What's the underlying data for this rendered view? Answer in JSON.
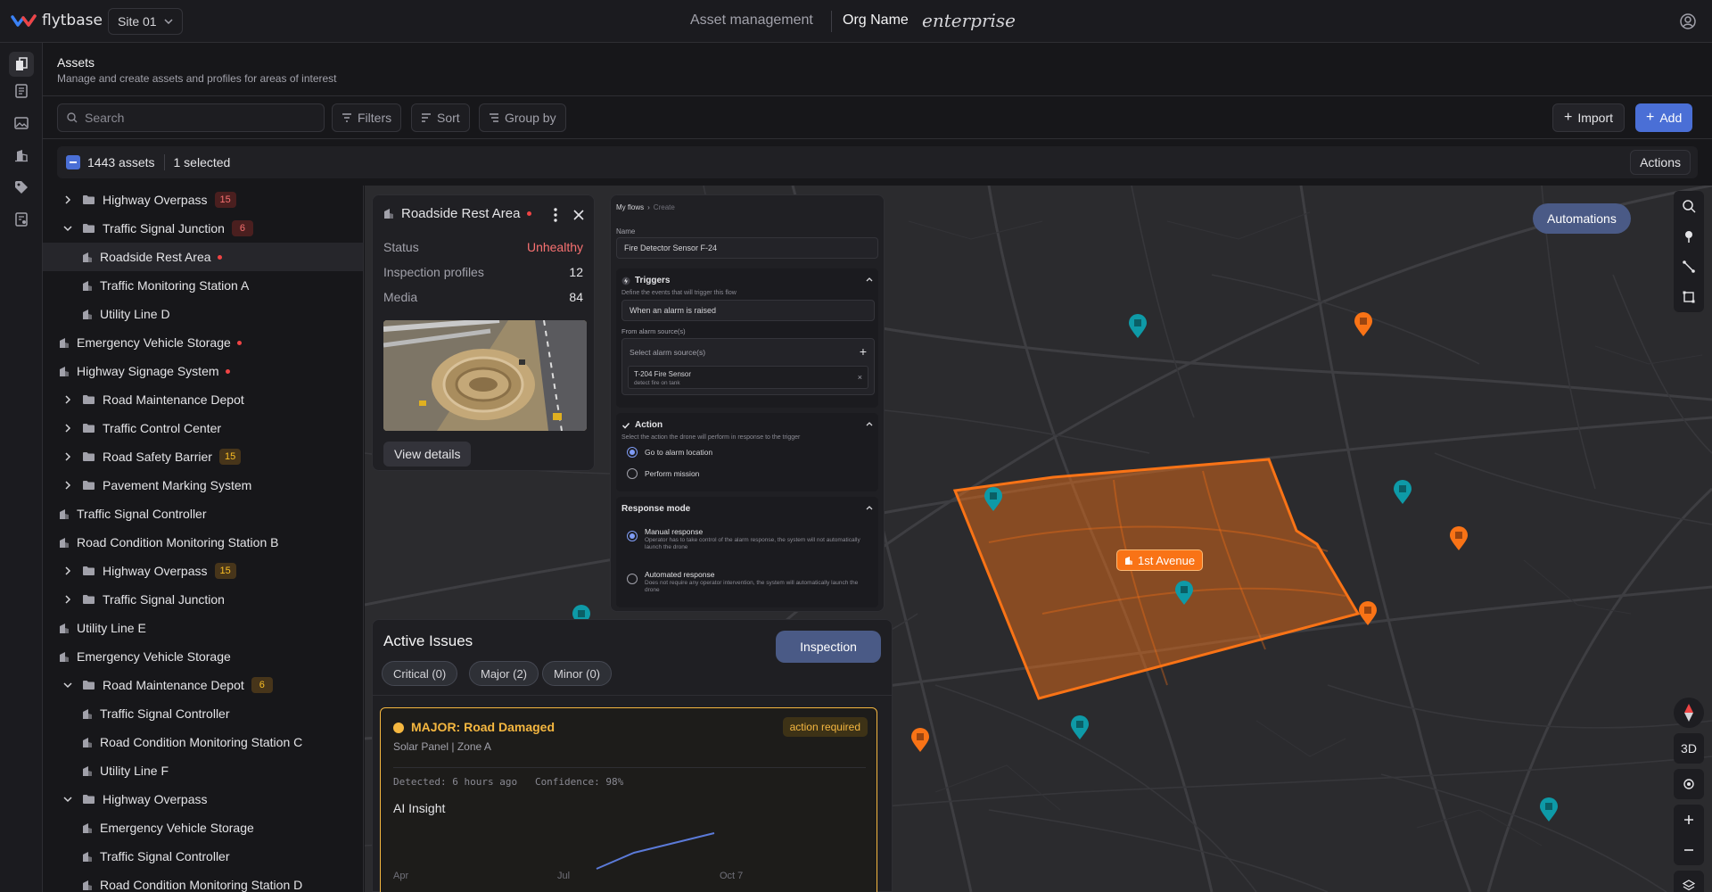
{
  "app": {
    "logo_text": "flytbase",
    "site": "Site 01",
    "page_title": "Asset management",
    "org_name": "Org Name",
    "plan": "enterprise"
  },
  "header": {
    "title": "Assets",
    "subtitle": "Manage and create assets and profiles for areas of interest"
  },
  "toolbar": {
    "search_placeholder": "Search",
    "filters": "Filters",
    "sort": "Sort",
    "group_by": "Group by",
    "import": "Import",
    "add": "Add"
  },
  "selection": {
    "count": "1443 assets",
    "selected": "1 selected",
    "actions": "Actions"
  },
  "tree": [
    {
      "label": "Highway Overpass",
      "level": 1,
      "type": "folder",
      "expanded": false,
      "count": "15",
      "badge": "red"
    },
    {
      "label": "Traffic Signal Junction",
      "level": 1,
      "type": "folder",
      "expanded": true,
      "count": "6",
      "badge": "red"
    },
    {
      "label": "Roadside Rest Area",
      "level": 2,
      "type": "asset",
      "alert": true,
      "selected": true
    },
    {
      "label": "Traffic Monitoring Station A",
      "level": 2,
      "type": "asset"
    },
    {
      "label": "Utility Line D",
      "level": 2,
      "type": "asset"
    },
    {
      "label": "Emergency Vehicle Storage",
      "level": 0,
      "type": "asset",
      "alert": true
    },
    {
      "label": "Highway Signage System",
      "level": 0,
      "type": "asset",
      "alert": true
    },
    {
      "label": "Road Maintenance Depot",
      "level": 1,
      "type": "folder",
      "expanded": false
    },
    {
      "label": "Traffic Control Center",
      "level": 1,
      "type": "folder",
      "expanded": false
    },
    {
      "label": "Road Safety Barrier",
      "level": 1,
      "type": "folder",
      "expanded": false,
      "count": "15",
      "badge": "amber"
    },
    {
      "label": "Pavement Marking System",
      "level": 1,
      "type": "folder",
      "expanded": false
    },
    {
      "label": "Traffic Signal Controller",
      "level": 0,
      "type": "asset"
    },
    {
      "label": "Road Condition Monitoring Station B",
      "level": 0,
      "type": "asset"
    },
    {
      "label": "Highway Overpass",
      "level": 1,
      "type": "folder",
      "expanded": false,
      "count": "15",
      "badge": "amber"
    },
    {
      "label": "Traffic Signal Junction",
      "level": 1,
      "type": "folder",
      "expanded": false
    },
    {
      "label": "Utility Line E",
      "level": 0,
      "type": "asset"
    },
    {
      "label": "Emergency Vehicle Storage",
      "level": 0,
      "type": "asset"
    },
    {
      "label": "Road Maintenance Depot",
      "level": 1,
      "type": "folder",
      "expanded": true,
      "count": "6",
      "badge": "amber"
    },
    {
      "label": "Traffic Signal Controller",
      "level": 2,
      "type": "asset"
    },
    {
      "label": "Road Condition Monitoring Station C",
      "level": 2,
      "type": "asset"
    },
    {
      "label": "Utility Line F",
      "level": 2,
      "type": "asset"
    },
    {
      "label": "Highway Overpass",
      "level": 1,
      "type": "folder",
      "expanded": true
    },
    {
      "label": "Emergency Vehicle Storage",
      "level": 2,
      "type": "asset"
    },
    {
      "label": "Traffic Signal Controller",
      "level": 2,
      "type": "asset"
    },
    {
      "label": "Road Condition Monitoring Station D",
      "level": 2,
      "type": "asset"
    }
  ],
  "asset_card": {
    "title": "Roadside Rest Area",
    "status_label": "Status",
    "status_value": "Unhealthy",
    "profiles_label": "Inspection profiles",
    "profiles_value": "12",
    "media_label": "Media",
    "media_value": "84",
    "view_details": "View details"
  },
  "flow": {
    "breadcrumb_1": "My flows",
    "breadcrumb_2": "Create",
    "name_label": "Name",
    "name_value": "Fire Detector Sensor F-24",
    "triggers_title": "Triggers",
    "triggers_desc": "Define the events that will trigger this flow",
    "trigger_value": "When an alarm is raised",
    "alarm_source_label": "From alarm source(s)",
    "alarm_source_placeholder": "Select alarm source(s)",
    "sensor_name": "T-204 Fire Sensor",
    "sensor_desc": "detect fire on tank",
    "action_title": "Action",
    "action_desc": "Select the action the drone will perform in response to the trigger",
    "action_opt1": "Go to alarm location",
    "action_opt2": "Perform mission",
    "response_title": "Response mode",
    "resp_opt1": "Manual response",
    "resp_opt1_desc": "Operator has to take control of the alarm response, the system will not automatically launch the drone",
    "resp_opt2": "Automated response",
    "resp_opt2_desc": "Does not require any operator intervention, the system will automatically launch the drone"
  },
  "issues": {
    "title": "Active Issues",
    "inspection": "Inspection",
    "chips": [
      "Critical (0)",
      "Major (2)",
      "Minor (0)"
    ],
    "issue_title": "MAJOR: Road Damaged",
    "issue_badge": "action required",
    "issue_sub": "Solar Panel | Zone A",
    "issue_meta": "Detected: 6 hours ago   Confidence: 98%",
    "insight_title": "AI Insight",
    "insight_axis": [
      "Apr",
      "Jul",
      "Oct 7"
    ]
  },
  "map": {
    "automations": "Automations",
    "polygon_label": "1st Avenue",
    "btn_3d": "3D",
    "accent": "#f97316",
    "pin_teal": "#0e9aa7",
    "pin_orange": "#f97316"
  },
  "colors": {
    "primary": "#4a6fd6",
    "unhealthy": "#f87171",
    "major": "#f5b740"
  }
}
